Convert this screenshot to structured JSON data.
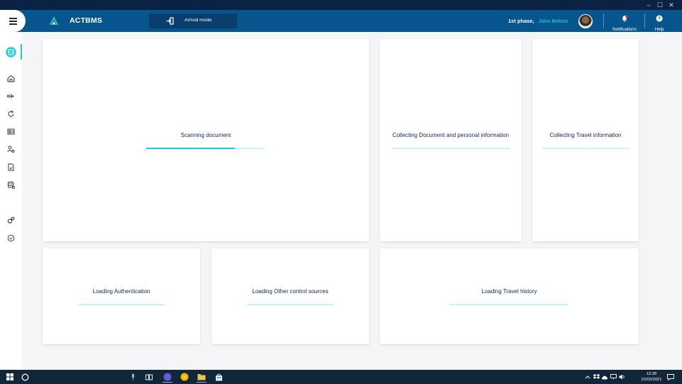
{
  "window": {
    "minimize": "–",
    "maximize": "☐",
    "close": "✕"
  },
  "header": {
    "app_name": "ACTBMS",
    "mode_label": "Arrival mode",
    "phase": "1st phase,",
    "user_name": "Jairo Beloso",
    "notifications_label": "Notifications",
    "help_label": "Help"
  },
  "sidebar": {
    "items": [
      {
        "icon": "user-badge-icon",
        "active": true
      },
      {
        "icon": "home-icon"
      },
      {
        "icon": "flow-icon"
      },
      {
        "icon": "refresh-icon"
      },
      {
        "icon": "table-icon"
      },
      {
        "icon": "people-settings-icon"
      },
      {
        "icon": "document-check-icon"
      },
      {
        "icon": "database-settings-icon"
      },
      {
        "icon": "gears-icon"
      },
      {
        "icon": "check-circle-icon"
      }
    ]
  },
  "cards": [
    {
      "title": "Scanning document",
      "progress": 0.75
    },
    {
      "title": "Collecting Document and personal information",
      "progress": 0
    },
    {
      "title": "Collecting Travel information",
      "progress": 0
    },
    {
      "title": "Loading Authentication",
      "progress": 0
    },
    {
      "title": "Loading Other control sources",
      "progress": 0
    },
    {
      "title": "Loading Travel history",
      "progress": 0
    }
  ],
  "taskbar": {
    "time": "12:28",
    "date": "22/02/2021"
  },
  "colors": {
    "appbar": "#07558f",
    "accent": "#21cbd8",
    "track": "#c9f3f7"
  }
}
